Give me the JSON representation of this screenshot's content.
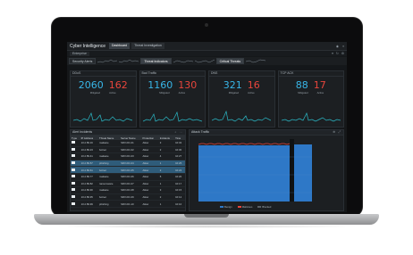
{
  "app": {
    "title": "Cyber Intelligence"
  },
  "tabs": [
    {
      "label": "Dashboard"
    },
    {
      "label": "Threat Investigation"
    }
  ],
  "toolbar": {
    "filter": "Enterprise"
  },
  "nav": {
    "items": [
      "Security Alerts",
      "Threat Indicators",
      "Critical Threats"
    ]
  },
  "kpis": [
    {
      "title": "DDoS",
      "ok": "2060",
      "bad": "162",
      "ok_label": "Mitigated",
      "bad_label": "Active"
    },
    {
      "title": "Bad Traffic",
      "ok": "1160",
      "bad": "130",
      "ok_label": "Mitigated",
      "bad_label": "Active"
    },
    {
      "title": "DNS",
      "ok": "321",
      "bad": "16",
      "ok_label": "Mitigated",
      "bad_label": "Active"
    },
    {
      "title": "TCP ACK",
      "ok": "88",
      "bad": "17",
      "ok_label": "Mitigated",
      "bad_label": "Active"
    }
  ],
  "table": {
    "title": "Alert Incidents",
    "columns": [
      "Type",
      "IP Address",
      "Threat Name",
      "Server Name",
      "Protection",
      "Incidents",
      "Time"
    ],
    "rows": [
      [
        "",
        "10.2.89.16",
        "malware",
        "SRV-DC-01",
        "Allow",
        "3",
        "10:32"
      ],
      [
        "",
        "10.2.89.23",
        "botnet",
        "SRV-DC-02",
        "Allow",
        "2",
        "10:30"
      ],
      [
        "",
        "10.2.89.41",
        "malware",
        "SRV-DC-03",
        "Allow",
        "4",
        "10:27"
      ],
      [
        "",
        "10.2.89.57",
        "phishing",
        "SRV-DC-04",
        "Allow",
        "1",
        "10:25"
      ],
      [
        "",
        "10.2.89.61",
        "botnet",
        "SRV-DC-05",
        "Allow",
        "2",
        "10:22"
      ],
      [
        "",
        "10.2.89.77",
        "malware",
        "SRV-DC-06",
        "Allow",
        "5",
        "10:20"
      ],
      [
        "",
        "10.2.89.82",
        "ransomware",
        "SRV-DC-07",
        "Allow",
        "1",
        "10:17"
      ],
      [
        "",
        "10.2.89.90",
        "malware",
        "SRV-DC-08",
        "Allow",
        "3",
        "10:15"
      ],
      [
        "",
        "10.2.89.95",
        "botnet",
        "SRV-DC-09",
        "Allow",
        "2",
        "10:12"
      ],
      [
        "",
        "10.2.89.99",
        "phishing",
        "SRV-DC-10",
        "Allow",
        "1",
        "10:10"
      ]
    ]
  },
  "traffic": {
    "title": "Attack Traffic",
    "legend": [
      "Benign",
      "Malicious",
      "Blocked"
    ],
    "colors": {
      "benign": "#2e78c7",
      "malicious": "#e8453c",
      "blocked": "#5a5f66"
    }
  },
  "colors": {
    "ok": "#38b6e8",
    "bad": "#e8453c",
    "spark": "#2bb9c7"
  }
}
